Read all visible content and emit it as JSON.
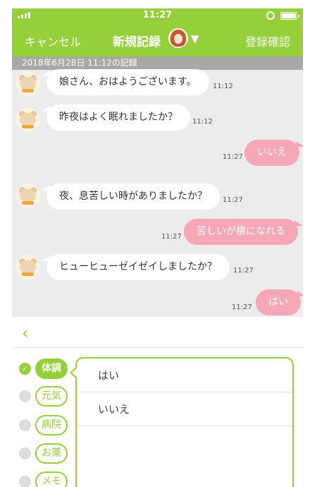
{
  "status_bar": {
    "time": "11:27"
  },
  "nav": {
    "cancel": "キャンセル",
    "title": "新規記録",
    "caret": "▼",
    "confirm": "登録確認"
  },
  "chat": {
    "date_header": "2018年6月28日 11:12の記録",
    "messages": [
      {
        "from": "bot",
        "text": "娘さん、おはようございます。",
        "time": "11:12"
      },
      {
        "from": "bot",
        "text": "昨夜はよく眠れましたか？",
        "time": "11:12"
      },
      {
        "from": "user",
        "text": "いいえ",
        "time": "11:27"
      },
      {
        "from": "bot",
        "text": "夜、息苦しい時がありましたか？",
        "time": "11:27"
      },
      {
        "from": "user",
        "text": "苦しいが横になれる",
        "time": "11:27"
      },
      {
        "from": "bot",
        "text": "ヒューヒューゼイゼイしましたか？",
        "time": "11:27"
      },
      {
        "from": "user",
        "text": "はい",
        "time": "11:27"
      }
    ]
  },
  "panel": {
    "back_icon": "chevron-left-icon",
    "categories": [
      {
        "label": "体調",
        "selected": true
      },
      {
        "label": "元気",
        "selected": false
      },
      {
        "label": "病院",
        "selected": false
      },
      {
        "label": "お薬",
        "selected": false
      },
      {
        "label": "メモ",
        "selected": false
      }
    ],
    "options": [
      "はい",
      "いいえ"
    ]
  },
  "colors": {
    "accent": "#95cf3a",
    "user_bubble": "#f6a8b7",
    "chat_bg": "#ececec",
    "date_bar": "#a8a8a8"
  }
}
